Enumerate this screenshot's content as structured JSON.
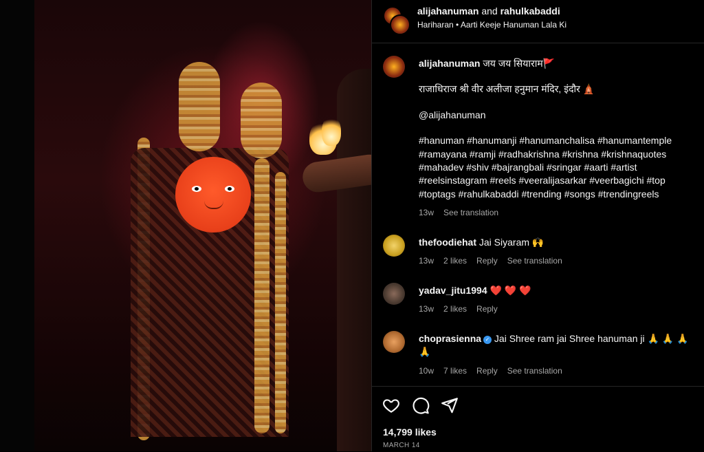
{
  "header": {
    "user1": "alijahanuman",
    "and_text": "and",
    "user2": "rahulkabaddi",
    "audio": "Hariharan • Aarti Keeje Hanuman Lala Ki"
  },
  "caption": {
    "username": "alijahanuman",
    "line1": " जय जय सियाराम🚩",
    "line2": "राजाधिराज श्री वीर अलीजा हनुमान मंदिर, इंदौर 🛕",
    "line3": "@alijahanuman",
    "hashtags": "#hanuman #hanumanji #hanumanchalisa #hanumantemple #ramayana #ramji #radhakrishna #krishna #krishnaquotes #mahadev #shiv #bajrangbali #sringar #aarti #artist #reelsinstagram #reels #veeralijasarkar #veerbagichi #top #toptags #rahulkabaddi #trending #songs #trendingreels",
    "time": "13w",
    "see_translation": "See translation"
  },
  "comments": [
    {
      "username": "thefoodiehat",
      "text": "Jai Siyaram 🙌",
      "time": "13w",
      "likes": "2 likes",
      "reply": "Reply",
      "translate": "See translation"
    },
    {
      "username": "yadav_jitu1994",
      "text": "❤️ ❤️ ❤️",
      "time": "13w",
      "likes": "2 likes",
      "reply": "Reply"
    },
    {
      "username": "choprasienna",
      "text": "Jai Shree ram jai Shree hanuman ji 🙏 🙏 🙏 🙏",
      "time": "10w",
      "likes": "7 likes",
      "reply": "Reply",
      "translate": "See translation"
    }
  ],
  "footer": {
    "likes": "14,799 likes",
    "date": "MARCH 14"
  },
  "icons": {
    "like": "heart-icon",
    "comment": "comment-icon",
    "share": "share-icon",
    "verified": "verified-badge-icon"
  },
  "colors": {
    "background": "#000000",
    "text": "#f5f5f5",
    "secondary": "#a8a8a8",
    "verified": "#3897f0",
    "divider": "#262626"
  }
}
